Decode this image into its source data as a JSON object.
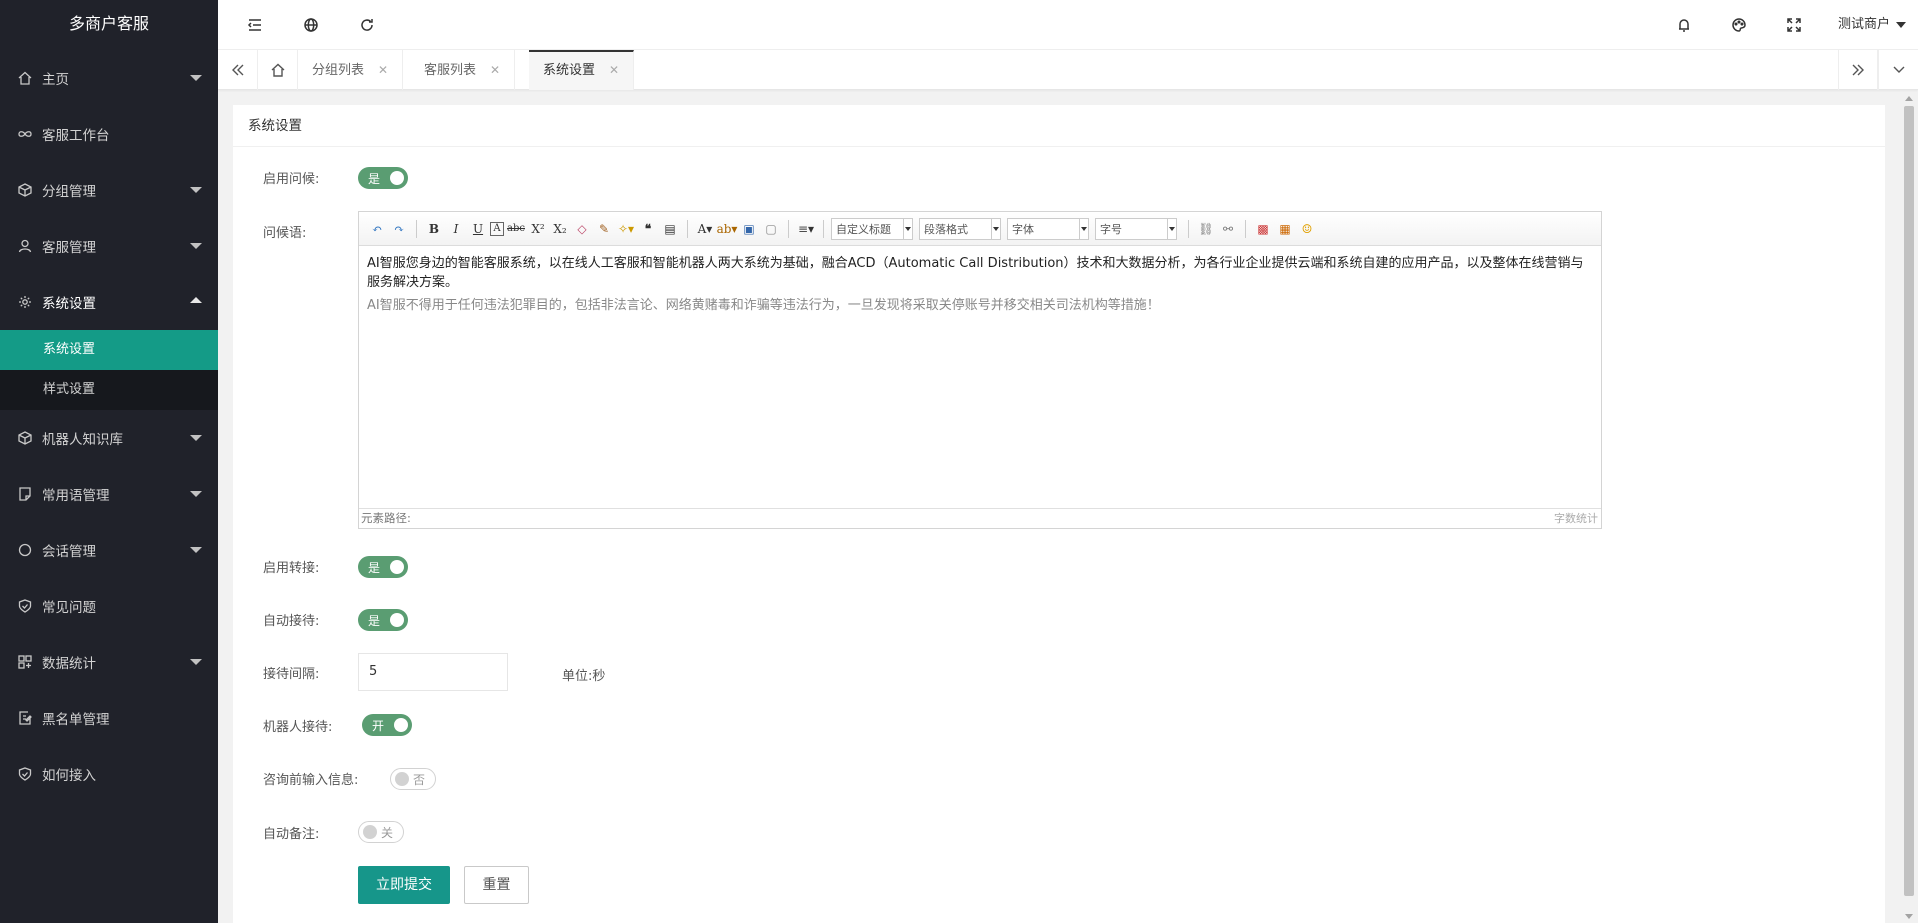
{
  "app": {
    "title": "多商户客服"
  },
  "sidebar": {
    "items": [
      {
        "label": "主页",
        "icon": "home-icon"
      },
      {
        "label": "客服工作台",
        "icon": "infinity-icon"
      },
      {
        "label": "分组管理",
        "icon": "cube-icon"
      },
      {
        "label": "客服管理",
        "icon": "user-icon"
      },
      {
        "label": "系统设置",
        "icon": "gear-icon"
      },
      {
        "label": "机器人知识库",
        "icon": "cube-icon"
      },
      {
        "label": "常用语管理",
        "icon": "note-icon"
      },
      {
        "label": "会话管理",
        "icon": "circle-icon"
      },
      {
        "label": "常见问题",
        "icon": "shield-check-icon"
      },
      {
        "label": "数据统计",
        "icon": "dashboard-icon"
      },
      {
        "label": "黑名单管理",
        "icon": "edit-doc-icon"
      },
      {
        "label": "如何接入",
        "icon": "shield-check-icon"
      }
    ],
    "subitems": [
      {
        "label": "系统设置"
      },
      {
        "label": "样式设置"
      }
    ]
  },
  "header": {
    "user": "测试商户"
  },
  "tabs": [
    {
      "label": "分组列表"
    },
    {
      "label": "客服列表"
    },
    {
      "label": "系统设置"
    }
  ],
  "form": {
    "card_title": "系统设置",
    "enable_greeting": {
      "label": "启用问候:",
      "value": "是"
    },
    "greeting": {
      "label": "问候语:",
      "line1": "AI智服您身边的智能客服系统，以在线人工客服和智能机器人两大系统为基础，融合ACD（Automatic Call Distribution）技术和大数据分析，为各行业企业提供云端和系统自建的应用产品，以及整体在线营销与服务解决方案。",
      "line2": "AI智服不得用于任何违法犯罪目的，包括非法言论、网络黄赌毒和诈骗等违法行为，一旦发现将采取关停账号并移交相关司法机构等措施！",
      "path_label": "元素路径:",
      "word_count": "字数统计"
    },
    "editor_toolbar": {
      "custom_title": "自定义标题",
      "paragraph": "段落格式",
      "font": "字体",
      "size": "字号"
    },
    "enable_transfer": {
      "label": "启用转接:",
      "value": "是"
    },
    "auto_reception": {
      "label": "自动接待:",
      "value": "是"
    },
    "reception_interval": {
      "label": "接待间隔:",
      "value": "5",
      "unit": "单位:秒"
    },
    "robot_reception": {
      "label": "机器人接待:",
      "value": "开"
    },
    "pre_consult_info": {
      "label": "咨询前输入信息:",
      "value": "否"
    },
    "auto_note": {
      "label": "自动备注:",
      "value": "关"
    },
    "submit": "立即提交",
    "reset": "重置"
  },
  "colors": {
    "sidebar_bg": "#20222a",
    "accent": "#149b87",
    "switch_on": "#5a9d72"
  }
}
